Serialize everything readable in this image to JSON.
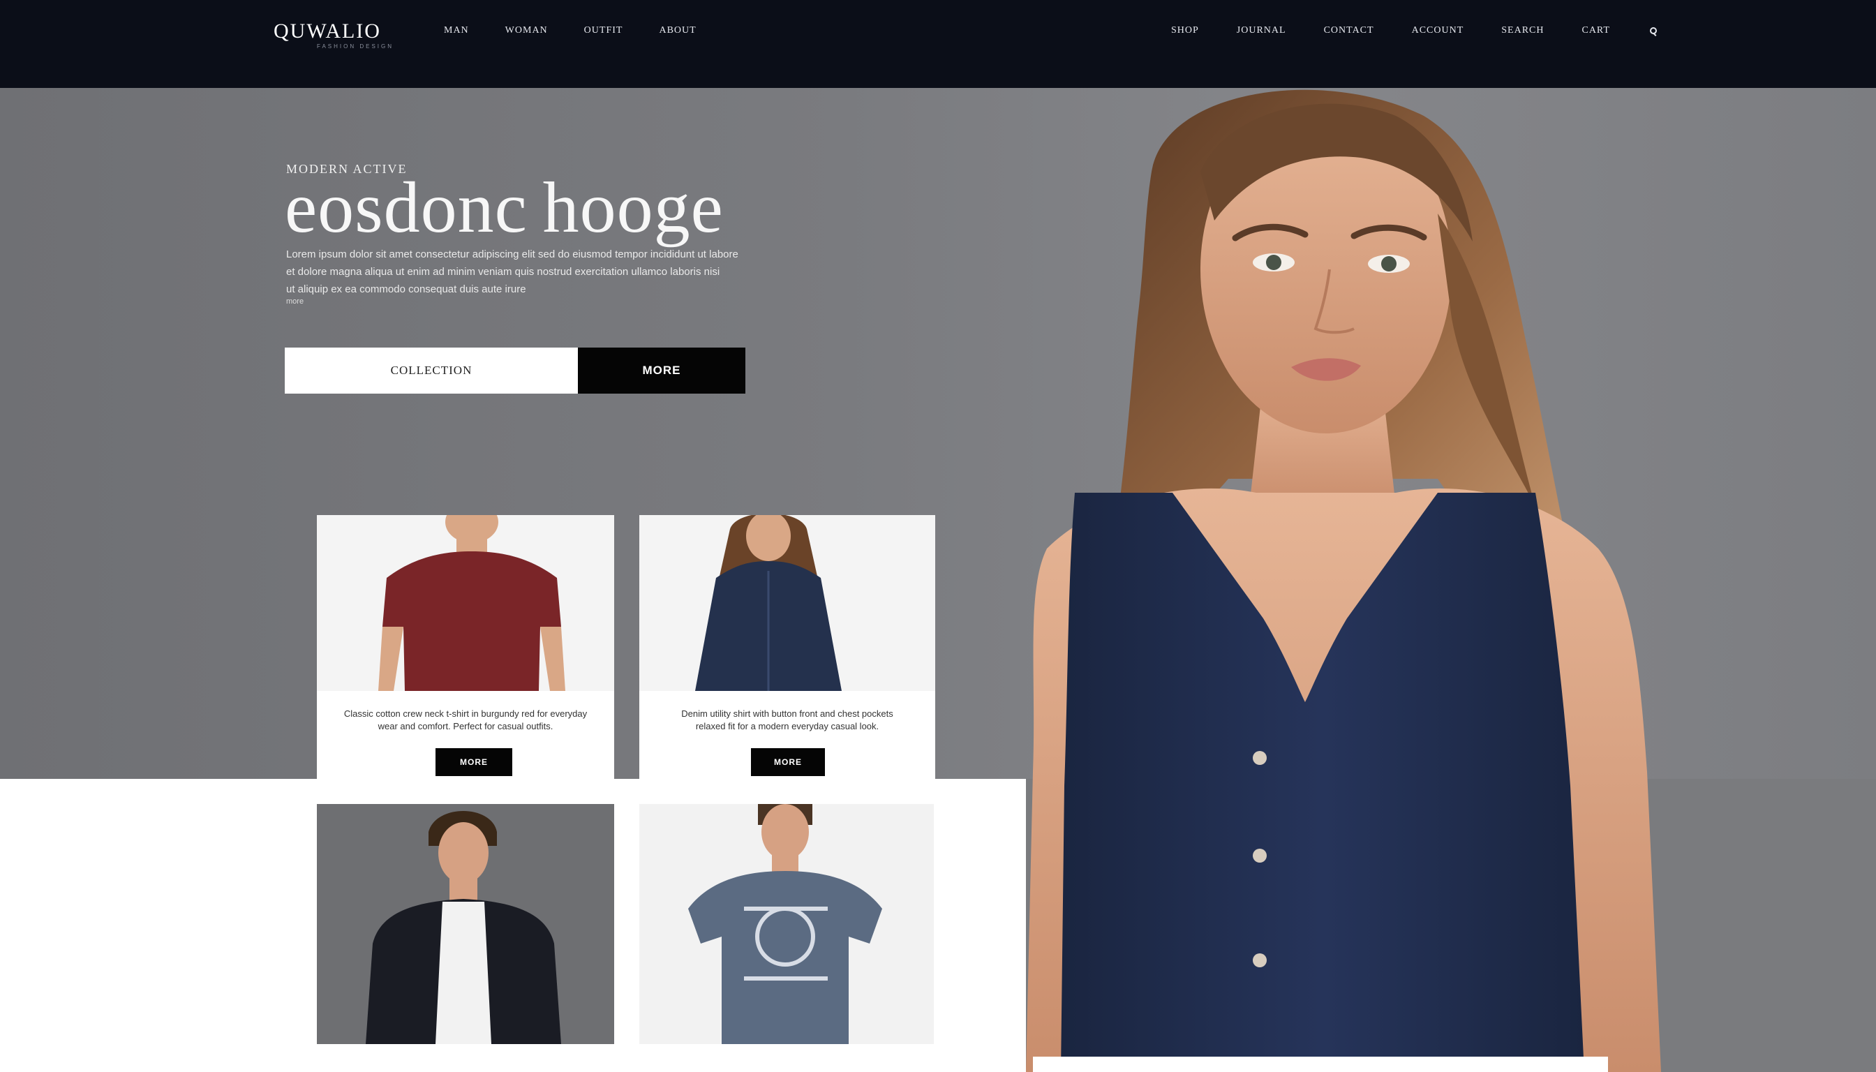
{
  "brand": {
    "logo": "QUWALIO",
    "tagline": "FASHION DESIGN"
  },
  "nav": {
    "left": [
      "MAN",
      "WOMAN",
      "OUTFIT",
      "ABOUT"
    ],
    "right": [
      "SHOP",
      "JOURNAL",
      "CONTACT",
      "ACCOUNT",
      "SEARCH",
      "CART"
    ],
    "search_icon": "search-icon"
  },
  "hero": {
    "eyebrow": "MODERN ACTIVE",
    "headline": "eosdonc hooge",
    "paragraph_lines": [
      "Lorem ipsum dolor sit amet consectetur adipiscing elit sed do eiusmod tempor incididunt ut labore",
      "et dolore magna aliqua ut enim ad minim veniam quis nostrud exercitation ullamco laboris nisi",
      "ut aliquip ex ea commodo consequat duis aute irure"
    ],
    "paragraph_note": "more",
    "cta_light": "COLLECTION",
    "cta_dark": "MORE"
  },
  "products": [
    {
      "text_lines": [
        "Classic cotton crew neck t-shirt in burgundy red for everyday",
        "wear and comfort. Perfect for casual outfits."
      ],
      "button": "MORE",
      "shirt_color": "#7a2528"
    },
    {
      "text_lines": [
        "Denim utility shirt with button front and chest pockets",
        "relaxed fit for a modern everyday casual look."
      ],
      "button": "MORE",
      "shirt_color": "#24314d"
    }
  ],
  "colors": {
    "topbar": "#0b0e18",
    "hero_bg": "#7a7b7f",
    "accent_dark": "#050505",
    "dress": "#1f2b45"
  }
}
